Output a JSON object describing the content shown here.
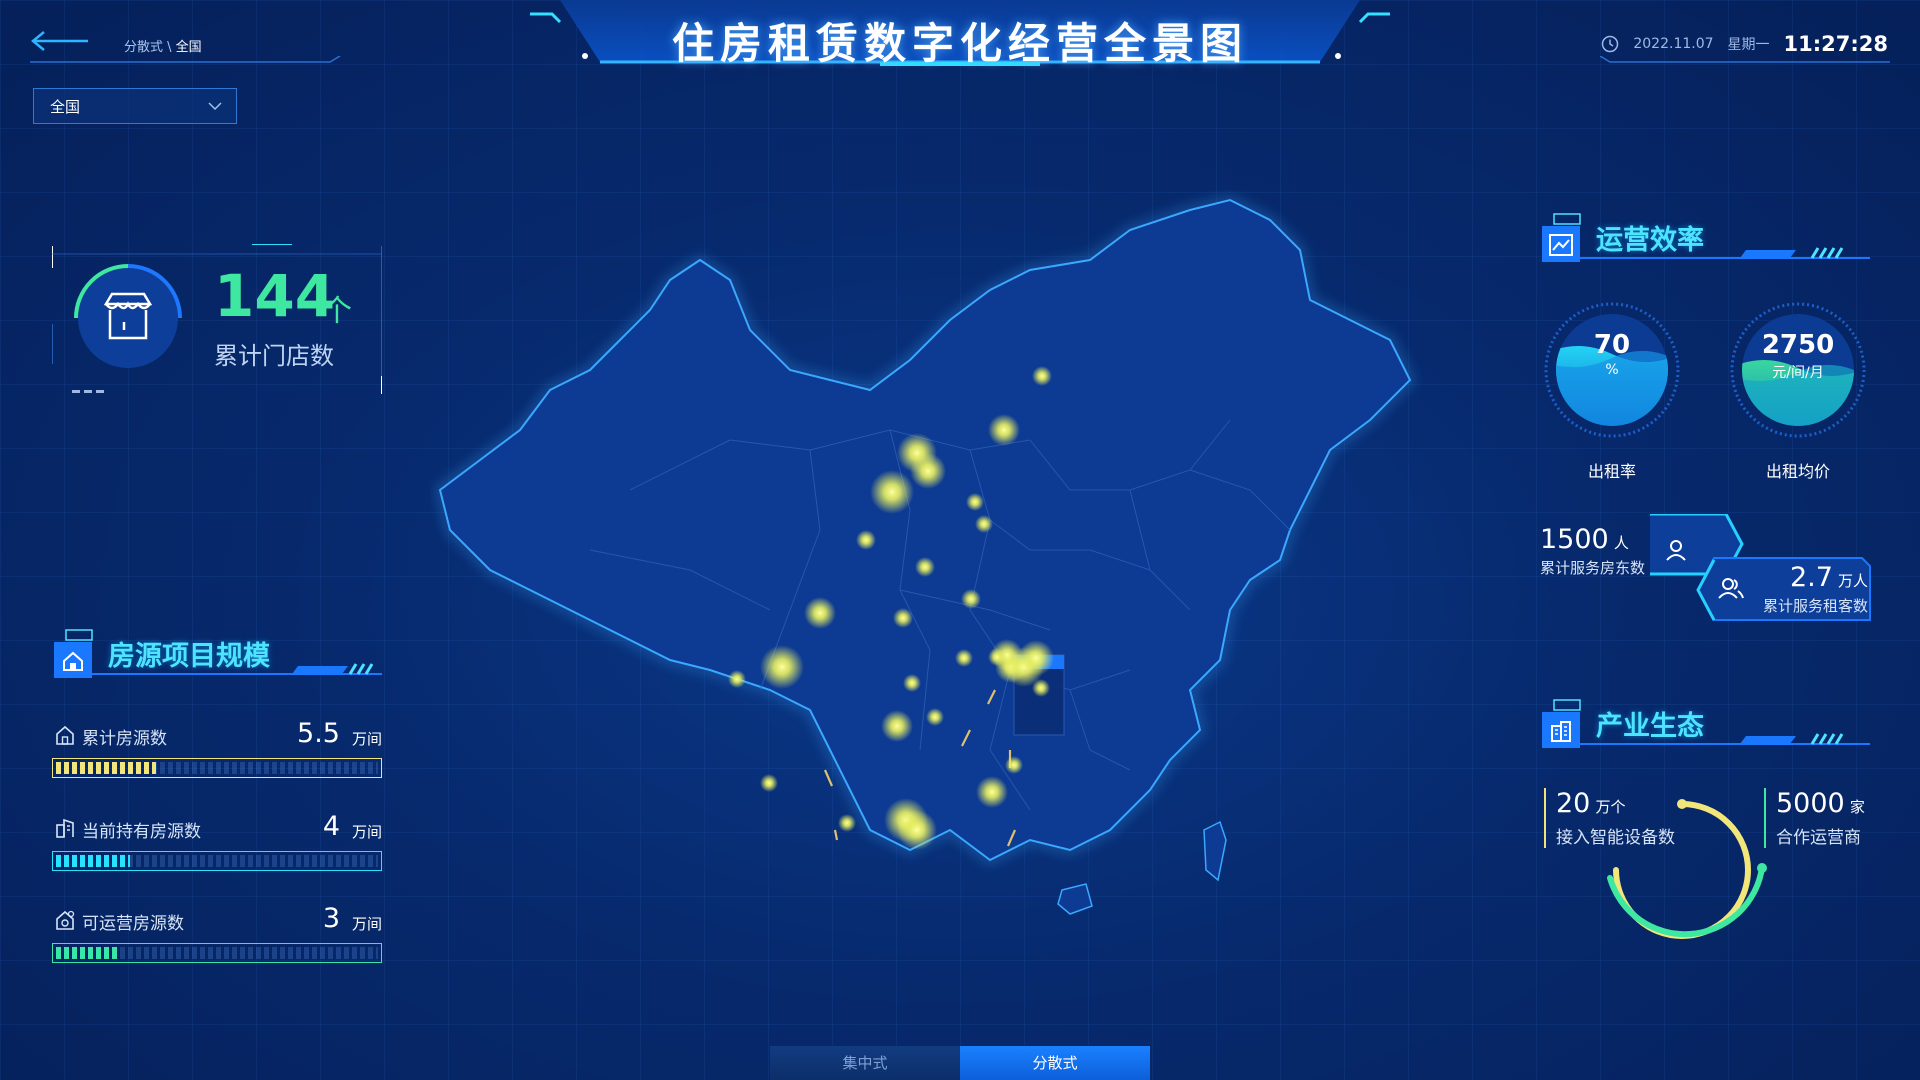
{
  "header": {
    "title": "住房租赁数字化经营全景图",
    "breadcrumb_parent": "分散式",
    "breadcrumb_sep": " \\ ",
    "breadcrumb_current": "全国",
    "date": "2022.11.07",
    "weekday": "星期一",
    "time": "11:27:28"
  },
  "region_select": {
    "value": "全国"
  },
  "store": {
    "value": "144",
    "unit": "个",
    "label": "累计门店数"
  },
  "housing": {
    "title": "房源项目规模",
    "items": [
      {
        "label": "累计房源数",
        "value": "5.5",
        "unit": "万间",
        "fill": 0.31,
        "color": "#f2e57a",
        "icon": "house-outline-icon"
      },
      {
        "label": "当前持有房源数",
        "value": "4",
        "unit": "万间",
        "fill": 0.23,
        "color": "#26e4ff",
        "icon": "building-outline-icon"
      },
      {
        "label": "可运营房源数",
        "value": "3",
        "unit": "万间",
        "fill": 0.19,
        "color": "#39e8a8",
        "icon": "house-gear-icon"
      }
    ]
  },
  "efficiency": {
    "title": "运营效率",
    "rent_rate": {
      "value": "70",
      "unit": "%",
      "label": "出租率"
    },
    "avg_rent": {
      "value": "2750",
      "unit": "元/间/月",
      "label": "出租均价"
    },
    "landlords": {
      "value": "1500",
      "unit": "人",
      "label": "累计服务房东数"
    },
    "tenants": {
      "value": "2.7",
      "unit": "万人",
      "label": "累计服务租客数"
    }
  },
  "ecology": {
    "title": "产业生态",
    "devices": {
      "value": "20",
      "unit": "万个",
      "label": "接入智能设备数"
    },
    "operators": {
      "value": "5000",
      "unit": "家",
      "label": "合作运营商"
    }
  },
  "tabs": [
    {
      "label": "集中式",
      "active": false
    },
    {
      "label": "分散式",
      "active": true
    }
  ],
  "colors": {
    "accent": "#4ee3ff",
    "green": "#3ee8a0",
    "yellow": "#f2e57a",
    "bg": "#072a6e"
  }
}
